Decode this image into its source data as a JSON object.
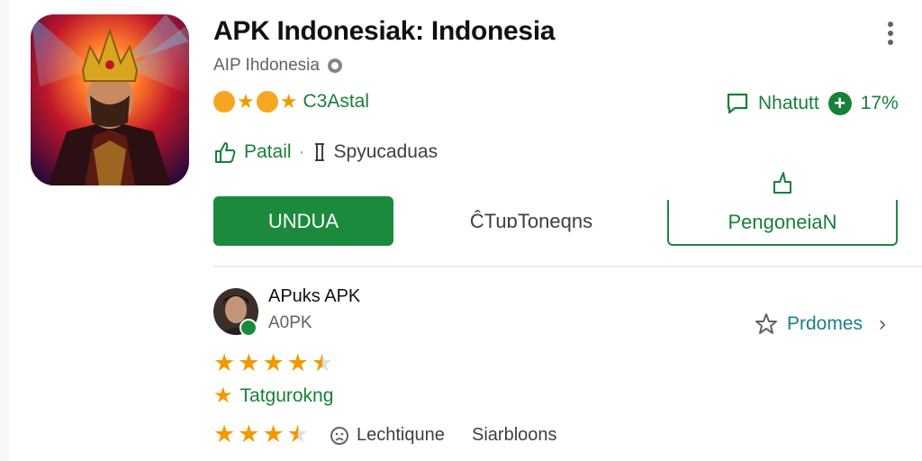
{
  "app": {
    "title": "APK Indonesiak: Indonesia",
    "developer": "AIP Ihdonesia",
    "emoji_rating_label": "C3Astal",
    "stat_label": "Nhatutt",
    "stat_value": "17%",
    "meta_green": "Patail",
    "meta_grey": "Spyucaduas",
    "icon_name": "game-king-art-icon"
  },
  "actions": {
    "primary_label": "UNDUA",
    "secondary_label": "ĈTuɒToneqns",
    "outline_label": "PengoneiaN"
  },
  "review": {
    "name": "APuks APK",
    "sub": "A0PK",
    "promo_label": "Prdomes",
    "rating_1": 4.5,
    "tag_label": "Tatgurokng",
    "rating_2": 3.5,
    "bottom_label_1": "Lechtiqune",
    "bottom_label_2": "Siarbloons"
  },
  "colors": {
    "accent_green": "#1c8a3c",
    "star": "#f29900",
    "teal_link": "#1a7f8a"
  }
}
